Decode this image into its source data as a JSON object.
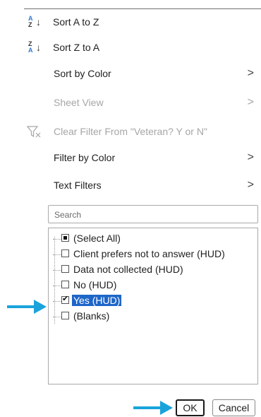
{
  "menu": {
    "sort_az": {
      "label": "Sort A to Z",
      "icon": "sort-ascending-icon"
    },
    "sort_za": {
      "label": "Sort Z to A",
      "icon": "sort-descending-icon"
    },
    "sort_by_color": {
      "label": "Sort by Color"
    },
    "sheet_view": {
      "label": "Sheet View"
    },
    "clear_filter": {
      "label": "Clear Filter From \"Veteran? Y or N\"",
      "icon": "clear-filter-icon"
    },
    "filter_by_color": {
      "label": "Filter by Color"
    },
    "text_filters": {
      "label": "Text Filters"
    },
    "submenu_chevron": ">"
  },
  "sort_icon_letters": {
    "a": "A",
    "z": "Z",
    "arrow": "↓"
  },
  "search": {
    "placeholder": "Search",
    "value": ""
  },
  "filter_list": {
    "items": [
      {
        "label": "(Select All)",
        "state": "mixed"
      },
      {
        "label": "Client prefers not to answer (HUD)",
        "state": "unchecked"
      },
      {
        "label": "Data not collected (HUD)",
        "state": "unchecked"
      },
      {
        "label": "No (HUD)",
        "state": "unchecked"
      },
      {
        "label": "Yes (HUD)",
        "state": "checked"
      },
      {
        "label": "(Blanks)",
        "state": "unchecked"
      }
    ]
  },
  "buttons": {
    "ok": "OK",
    "cancel": "Cancel"
  },
  "colors": {
    "accent": "#1e66c8",
    "pointer": "#1aa3db",
    "disabled": "#a6a6a6"
  }
}
